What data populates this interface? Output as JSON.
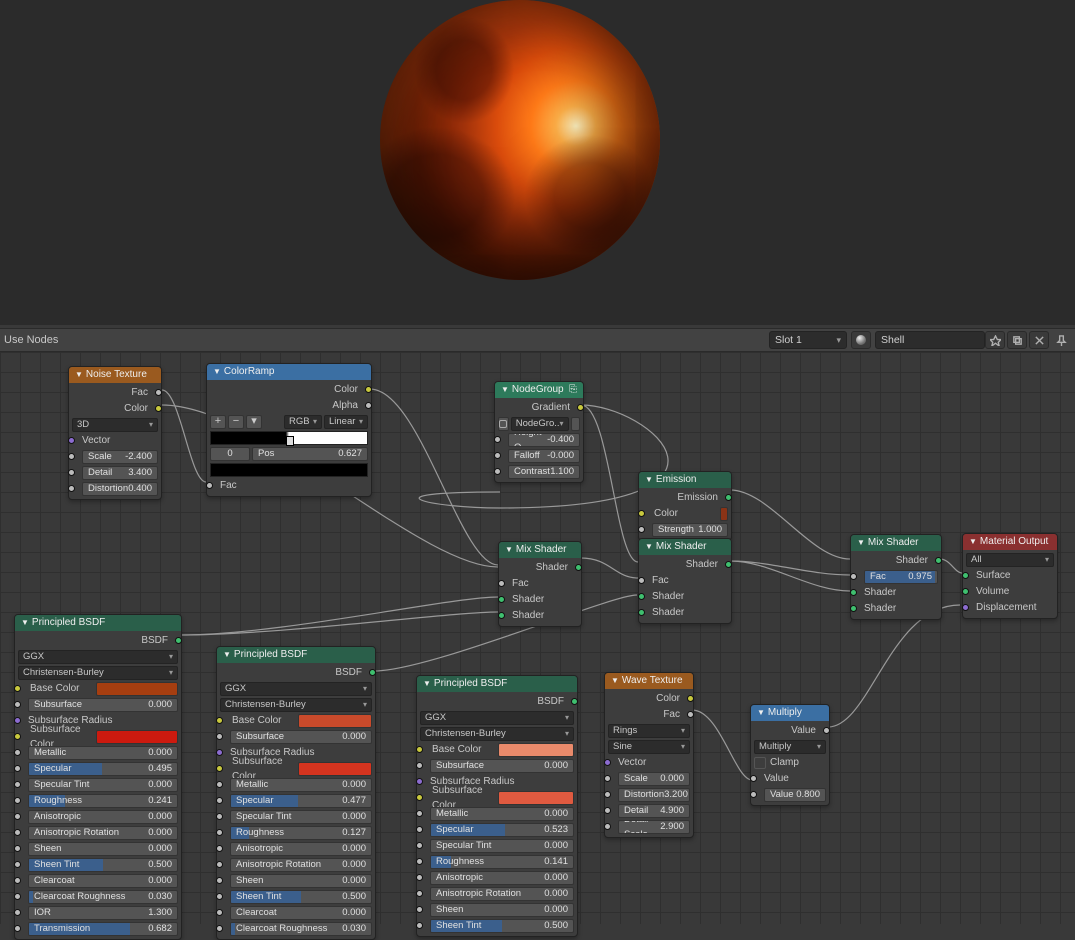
{
  "header": {
    "use_nodes": "Use Nodes",
    "slot": "Slot 1",
    "material": "Shell"
  },
  "noise_texture": {
    "title": "Noise Texture",
    "out_fac": "Fac",
    "out_color": "Color",
    "dims": "3D",
    "vector": "Vector",
    "scale": {
      "label": "Scale",
      "value": "-2.400"
    },
    "detail": {
      "label": "Detail",
      "value": "3.400"
    },
    "distortion": {
      "label": "Distortion",
      "value": "0.400"
    }
  },
  "color_ramp": {
    "title": "ColorRamp",
    "out_color": "Color",
    "out_alpha": "Alpha",
    "mode_rgb": "RGB",
    "mode_interp": "Linear",
    "stop_index": "0",
    "pos_label": "Pos",
    "pos_value": "0.627",
    "in_fac": "Fac"
  },
  "nodegroup": {
    "title": "NodeGroup",
    "out_gradient": "Gradient",
    "group_name": "NodeGro..",
    "height": {
      "label": "Height O",
      "value": "-0.400"
    },
    "falloff": {
      "label": "Falloff",
      "value": "-0.000"
    },
    "contrast": {
      "label": "Contrast",
      "value": "1.100"
    }
  },
  "emission": {
    "title": "Emission",
    "out_emission": "Emission",
    "color_label": "Color",
    "color_hex": "#8a3316",
    "strength": {
      "label": "Strength",
      "value": "1.000"
    }
  },
  "mix1": {
    "title": "Mix Shader",
    "out": "Shader",
    "fac": "Fac",
    "s1": "Shader",
    "s2": "Shader"
  },
  "mix2": {
    "title": "Mix Shader",
    "out": "Shader",
    "fac": "Fac",
    "s1": "Shader",
    "s2": "Shader"
  },
  "mix3": {
    "title": "Mix Shader",
    "out": "Shader",
    "fac": {
      "label": "Fac",
      "value": "0.975"
    },
    "s1": "Shader",
    "s2": "Shader"
  },
  "output": {
    "title": "Material Output",
    "mode": "All",
    "surface": "Surface",
    "volume": "Volume",
    "displacement": "Displacement"
  },
  "bsdf1": {
    "title": "Principled BSDF",
    "out": "BSDF",
    "dist": "GGX",
    "sss": "Christensen-Burley",
    "base_color_label": "Base Color",
    "base_color_hex": "#a63e10",
    "subsurface": {
      "label": "Subsurface",
      "value": "0.000",
      "fill": 0
    },
    "subsurface_radius": "Subsurface Radius",
    "subsurface_color_label": "Subsurface Color",
    "subsurface_color_hex": "#cc1a0f",
    "metallic": {
      "label": "Metallic",
      "value": "0.000",
      "fill": 0
    },
    "specular": {
      "label": "Specular",
      "value": "0.495",
      "fill": 49.5
    },
    "specular_tint": {
      "label": "Specular Tint",
      "value": "0.000",
      "fill": 0
    },
    "roughness": {
      "label": "Roughness",
      "value": "0.241",
      "fill": 24.1
    },
    "anisotropic": {
      "label": "Anisotropic",
      "value": "0.000",
      "fill": 0
    },
    "anisotropic_rotation": {
      "label": "Anisotropic Rotation",
      "value": "0.000",
      "fill": 0
    },
    "sheen": {
      "label": "Sheen",
      "value": "0.000",
      "fill": 0
    },
    "sheen_tint": {
      "label": "Sheen Tint",
      "value": "0.500",
      "fill": 50
    },
    "clearcoat": {
      "label": "Clearcoat",
      "value": "0.000",
      "fill": 0
    },
    "clearcoat_roughness": {
      "label": "Clearcoat Roughness",
      "value": "0.030",
      "fill": 3
    },
    "ior": {
      "label": "IOR",
      "value": "1.300"
    },
    "transmission": {
      "label": "Transmission",
      "value": "0.682",
      "fill": 68.2
    }
  },
  "bsdf2": {
    "title": "Principled BSDF",
    "out": "BSDF",
    "dist": "GGX",
    "sss": "Christensen-Burley",
    "base_color_label": "Base Color",
    "base_color_hex": "#c94a2b",
    "subsurface": {
      "label": "Subsurface",
      "value": "0.000",
      "fill": 0
    },
    "subsurface_radius": "Subsurface Radius",
    "subsurface_color_label": "Subsurface Color",
    "subsurface_color_hex": "#d5341f",
    "metallic": {
      "label": "Metallic",
      "value": "0.000",
      "fill": 0
    },
    "specular": {
      "label": "Specular",
      "value": "0.477",
      "fill": 47.7
    },
    "specular_tint": {
      "label": "Specular Tint",
      "value": "0.000",
      "fill": 0
    },
    "roughness": {
      "label": "Roughness",
      "value": "0.127",
      "fill": 12.7
    },
    "anisotropic": {
      "label": "Anisotropic",
      "value": "0.000",
      "fill": 0
    },
    "anisotropic_rotation": {
      "label": "Anisotropic Rotation",
      "value": "0.000",
      "fill": 0
    },
    "sheen": {
      "label": "Sheen",
      "value": "0.000",
      "fill": 0
    },
    "sheen_tint": {
      "label": "Sheen Tint",
      "value": "0.500",
      "fill": 50
    },
    "clearcoat": {
      "label": "Clearcoat",
      "value": "0.000",
      "fill": 0
    },
    "clearcoat_roughness": {
      "label": "Clearcoat Roughness",
      "value": "0.030",
      "fill": 3
    }
  },
  "bsdf3": {
    "title": "Principled BSDF",
    "out": "BSDF",
    "dist": "GGX",
    "sss": "Christensen-Burley",
    "base_color_label": "Base Color",
    "base_color_hex": "#e98a6b",
    "subsurface": {
      "label": "Subsurface",
      "value": "0.000",
      "fill": 0
    },
    "subsurface_radius": "Subsurface Radius",
    "subsurface_color_label": "Subsurface Color",
    "subsurface_color_hex": "#e05a40",
    "metallic": {
      "label": "Metallic",
      "value": "0.000",
      "fill": 0
    },
    "specular": {
      "label": "Specular",
      "value": "0.523",
      "fill": 52.3
    },
    "specular_tint": {
      "label": "Specular Tint",
      "value": "0.000",
      "fill": 0
    },
    "roughness": {
      "label": "Roughness",
      "value": "0.141",
      "fill": 14.1
    },
    "anisotropic": {
      "label": "Anisotropic",
      "value": "0.000",
      "fill": 0
    },
    "anisotropic_rotation": {
      "label": "Anisotropic Rotation",
      "value": "0.000",
      "fill": 0
    },
    "sheen": {
      "label": "Sheen",
      "value": "0.000",
      "fill": 0
    },
    "sheen_tint": {
      "label": "Sheen Tint",
      "value": "0.500",
      "fill": 50
    }
  },
  "wave": {
    "title": "Wave Texture",
    "out_color": "Color",
    "out_fac": "Fac",
    "type": "Rings",
    "profile": "Sine",
    "vector": "Vector",
    "scale": {
      "label": "Scale",
      "value": "0.000"
    },
    "distortion": {
      "label": "Distortion",
      "value": "3.200"
    },
    "detail": {
      "label": "Detail",
      "value": "4.900"
    },
    "detail_scale": {
      "label": "Detail Scale",
      "value": "2.900"
    }
  },
  "multiply": {
    "title": "Multiply",
    "out": "Value",
    "op": "Multiply",
    "clamp": "Clamp",
    "in_value": "Value",
    "value2": {
      "label": "Value",
      "value": "0.800"
    }
  }
}
